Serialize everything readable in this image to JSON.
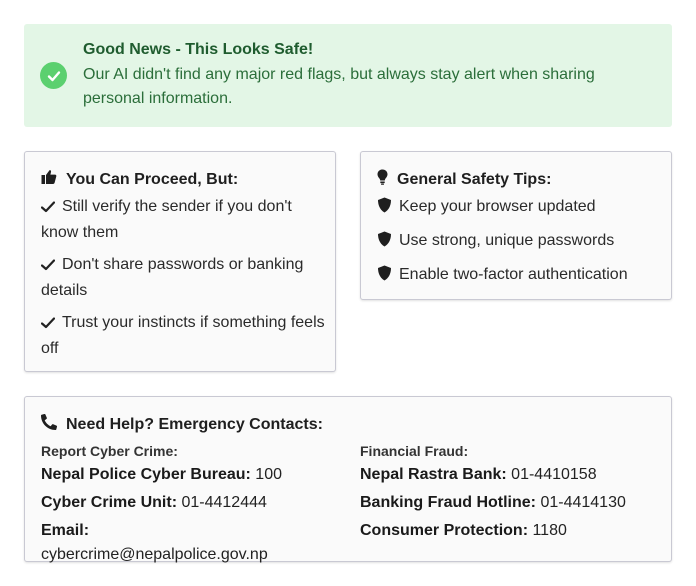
{
  "alert": {
    "title": "Good News - This Looks Safe!",
    "message": "Our AI didn't find any major red flags, but always stay alert when sharing personal information."
  },
  "proceed": {
    "title": "You Can Proceed, But:",
    "items": [
      "Still verify the sender if you don't know them",
      "Don't share passwords or banking details",
      "Trust your instincts if something feels off"
    ]
  },
  "tips": {
    "title": "General Safety Tips:",
    "items": [
      "Keep your browser updated",
      "Use strong, unique passwords",
      "Enable two-factor authentication"
    ]
  },
  "contacts": {
    "title": "Need Help? Emergency Contacts:",
    "left": {
      "heading": "Report Cyber Crime:",
      "rows": [
        {
          "label": "Nepal Police Cyber Bureau:",
          "value": "100"
        },
        {
          "label": "Cyber Crime Unit:",
          "value": "01-4412444"
        },
        {
          "label": "Email:",
          "value": "cybercrime@nepalpolice.gov.np"
        }
      ]
    },
    "right": {
      "heading": "Financial Fraud:",
      "rows": [
        {
          "label": "Nepal Rastra Bank:",
          "value": "01-4410158"
        },
        {
          "label": "Banking Fraud Hotline:",
          "value": "01-4414130"
        },
        {
          "label": "Consumer Protection:",
          "value": "1180"
        }
      ]
    }
  },
  "colors": {
    "alert_bg": "#e3f6e6",
    "success": "#5bd06f",
    "alert_text": "#1f5c2f"
  }
}
